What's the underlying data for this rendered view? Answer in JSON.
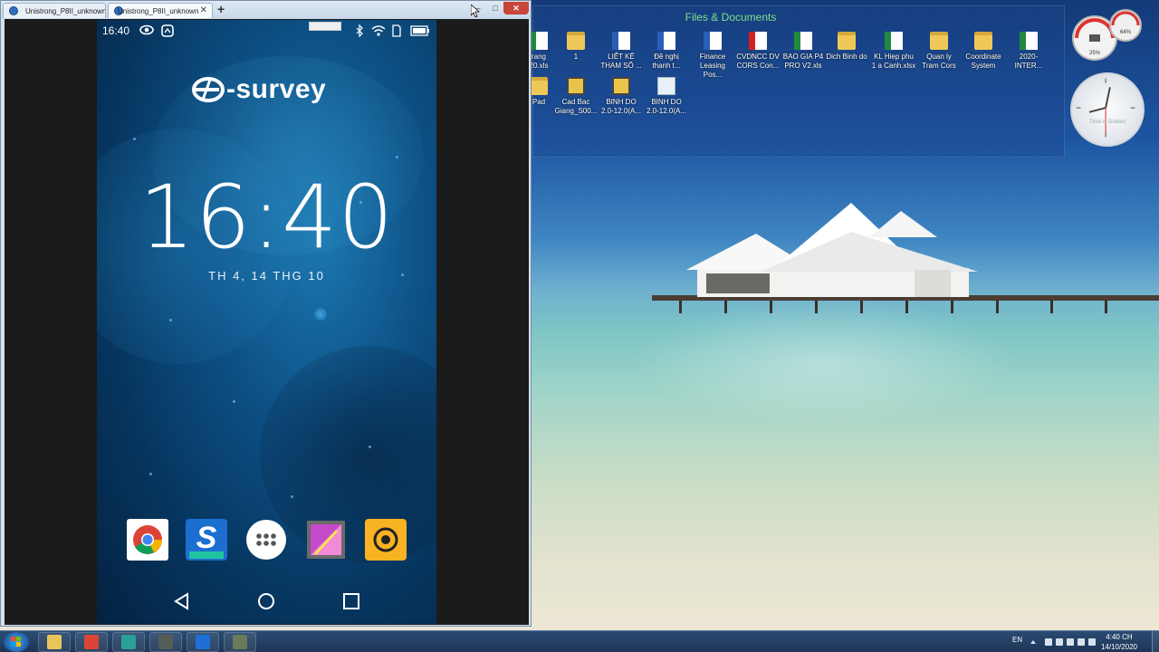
{
  "emulator": {
    "tabs": [
      {
        "label": "Unistrong_P8II_unknown",
        "active": false
      },
      {
        "label": "Unistrong_P8II_unknown",
        "active": true
      }
    ],
    "new_tab_symbol": "+",
    "controls": {
      "minimize": "–",
      "maximize": "□",
      "close": "✕"
    }
  },
  "android": {
    "status": {
      "time": "16:40",
      "icons": [
        "eye-icon",
        "cast-icon",
        "keyboard-icon",
        "bluetooth-icon",
        "wifi-icon",
        "sim-icon",
        "battery-icon"
      ]
    },
    "brand": "-survey",
    "clock": "16:40",
    "date": "TH 4, 14 THG 10",
    "dock": [
      {
        "name": "chrome",
        "icon": "chrome-icon"
      },
      {
        "name": "s-android",
        "icon": "s-android-icon"
      },
      {
        "name": "app-drawer",
        "icon": "apps-grid-icon"
      },
      {
        "name": "gallery",
        "icon": "gallery-icon"
      },
      {
        "name": "camera",
        "icon": "camera-icon"
      }
    ],
    "nav": [
      "back-icon",
      "home-icon",
      "recents-icon"
    ]
  },
  "desktop": {
    "fence_title": "Files & Documents",
    "icons_row1": [
      {
        "label": "rang\n20.xls",
        "type": "excel"
      },
      {
        "label": "1",
        "type": "folder"
      },
      {
        "label": "LIẾT KÊ\nTHAM SỐ ...",
        "type": "word"
      },
      {
        "label": "Đề nghị\nthanh t...",
        "type": "word"
      },
      {
        "label": "Finance\nLeasing Pos...",
        "type": "word"
      },
      {
        "label": "CVDNCC DV\nCORS Con...",
        "type": "pdf"
      },
      {
        "label": "BAO GIA P4\nPRO V2.xls",
        "type": "excel"
      },
      {
        "label": "Dich Binh do",
        "type": "folder"
      },
      {
        "label": "KL Hiep phu\n1 a Canh.xlsx",
        "type": "excel"
      },
      {
        "label": "Quan ly\nTram Cors",
        "type": "folder"
      },
      {
        "label": "Coordinate\nSystem",
        "type": "folder"
      },
      {
        "label": "2020-INTER...",
        "type": "excel"
      }
    ],
    "icons_row2": [
      {
        "label": "Pad",
        "type": "folder"
      },
      {
        "label": "Cad Bac\nGiang_S00...",
        "type": "dwg"
      },
      {
        "label": "BINH DO\n2.0-12.0(A...",
        "type": "dwg"
      },
      {
        "label": "BINH DO\n2.0-12.0(A...",
        "type": "file"
      }
    ],
    "gauge": {
      "cpu_percent": "25%",
      "mem_percent": "64%"
    },
    "clock_gadget": {
      "brand": "Time is Golden"
    }
  },
  "taskbar": {
    "apps": [
      "explorer-icon",
      "chrome-icon",
      "autocad-icon",
      "survey-app-icon",
      "teamviewer-icon",
      "sketch-icon"
    ],
    "language": "EN",
    "time": "4:40 CH",
    "date": "14/10/2020"
  },
  "colors": {
    "fence_title": "#7de08a",
    "close_button": "#c9463a",
    "phone_accent": "#0d5186"
  }
}
